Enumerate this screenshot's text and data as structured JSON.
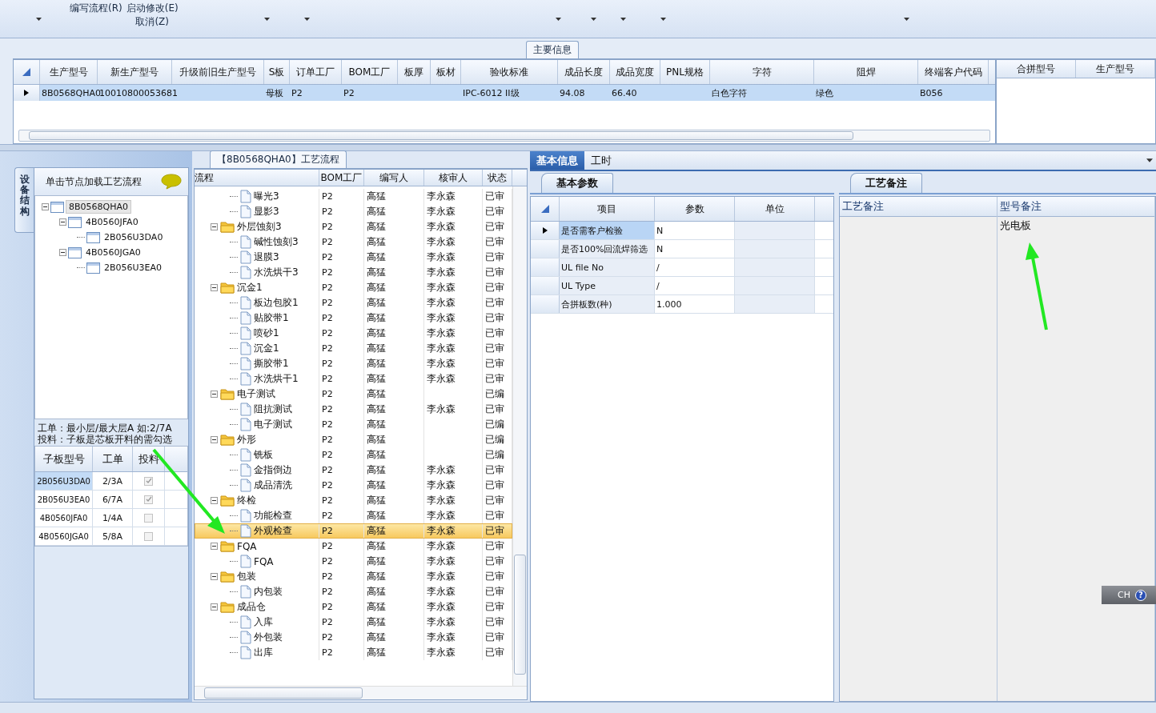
{
  "toolbar": [
    {
      "dropdown": true
    },
    {
      "lines": [
        "编写流程(R)"
      ]
    },
    {
      "lines": [
        "启动修改(E)",
        "取消(Z)"
      ]
    },
    {
      "dropdown": true
    },
    {
      "dropdown": true
    },
    {
      "dropdown": true
    },
    {
      "dropdown": true
    },
    {
      "dropdown": true
    },
    {
      "dropdown": true
    },
    {
      "dropdown": true
    }
  ],
  "main_info": {
    "title": "主要信息",
    "columns": [
      "生产型号",
      "新生产型号",
      "升级前旧生产型号",
      "S板",
      "订单工厂",
      "BOM工厂",
      "板厚",
      "板材",
      "验收标准",
      "成品长度",
      "成品宽度",
      "PNL规格",
      "字符",
      "阻焊",
      "终端客户代码"
    ],
    "rows": [
      {
        "selected": true,
        "cells": [
          "8B0568QHA0",
          "10010800053681",
          null,
          "母板",
          "P2",
          "P2",
          null,
          null,
          "IPC-6012 II级",
          "94.08",
          "66.40",
          null,
          "白色字符",
          "绿色",
          "B056"
        ]
      }
    ]
  },
  "merge_grid": {
    "columns": [
      "合拼型号",
      "生产型号"
    ]
  },
  "structure_panel": {
    "tab": "设备结构",
    "hint": "单击节点加载工艺流程",
    "tree": [
      {
        "label": "8B0568QHA0",
        "expanded": true,
        "selected": true,
        "children": [
          {
            "label": "4B0560JFA0",
            "expanded": true,
            "selected": false,
            "children": [
              {
                "label": "2B056U3DA0",
                "selected": false
              }
            ]
          },
          {
            "label": "4B0560JGA0",
            "expanded": true,
            "selected": false,
            "children": [
              {
                "label": "2B056U3EA0",
                "selected": false
              }
            ]
          }
        ]
      }
    ],
    "notes": [
      "工单：最小层/最大层A 如:2/7A",
      "投料：子板是芯板开料的需勾选"
    ],
    "sub_grid": {
      "columns": [
        "子板型号",
        "工单",
        "投料"
      ],
      "rows": [
        {
          "board": "2B056U3DA0",
          "order": "2/3A",
          "checked": true,
          "selected": true
        },
        {
          "board": "2B056U3EA0",
          "order": "6/7A",
          "checked": true,
          "selected": false
        },
        {
          "board": "4B0560JFA0",
          "order": "1/4A",
          "checked": false,
          "selected": false
        },
        {
          "board": "4B0560JGA0",
          "order": "5/8A",
          "checked": false,
          "selected": false
        }
      ]
    }
  },
  "process": {
    "title": "【8B0568QHA0】工艺流程",
    "columns": [
      "流程",
      "BOM工厂",
      "编写人",
      "核审人",
      "状态"
    ],
    "nodes": [
      {
        "kind": "step",
        "name": "曝光3",
        "factory": "P2",
        "writer": "高猛",
        "reviewer": "李永森",
        "status": "已审",
        "selected": false
      },
      {
        "kind": "step",
        "name": "显影3",
        "factory": "P2",
        "writer": "高猛",
        "reviewer": "李永森",
        "status": "已审",
        "selected": false
      },
      {
        "kind": "group",
        "name": "外层蚀刻3",
        "factory": "P2",
        "writer": "高猛",
        "reviewer": "李永森",
        "status": "已审",
        "selected": false,
        "expanded": true,
        "children": [
          {
            "kind": "step",
            "name": "碱性蚀刻3",
            "factory": "P2",
            "writer": "高猛",
            "reviewer": "李永森",
            "status": "已审",
            "selected": false
          },
          {
            "kind": "step",
            "name": "退膜3",
            "factory": "P2",
            "writer": "高猛",
            "reviewer": "李永森",
            "status": "已审",
            "selected": false
          },
          {
            "kind": "step",
            "name": "水洗烘干3",
            "factory": "P2",
            "writer": "高猛",
            "reviewer": "李永森",
            "status": "已审",
            "selected": false
          }
        ]
      },
      {
        "kind": "group",
        "name": "沉金1",
        "factory": "P2",
        "writer": "高猛",
        "reviewer": "李永森",
        "status": "已审",
        "selected": false,
        "expanded": true,
        "children": [
          {
            "kind": "step",
            "name": "板边包胶1",
            "factory": "P2",
            "writer": "高猛",
            "reviewer": "李永森",
            "status": "已审",
            "selected": false
          },
          {
            "kind": "step",
            "name": "贴胶带1",
            "factory": "P2",
            "writer": "高猛",
            "reviewer": "李永森",
            "status": "已审",
            "selected": false
          },
          {
            "kind": "step",
            "name": "喷砂1",
            "factory": "P2",
            "writer": "高猛",
            "reviewer": "李永森",
            "status": "已审",
            "selected": false
          },
          {
            "kind": "step",
            "name": "沉金1",
            "factory": "P2",
            "writer": "高猛",
            "reviewer": "李永森",
            "status": "已审",
            "selected": false
          },
          {
            "kind": "step",
            "name": "撕胶带1",
            "factory": "P2",
            "writer": "高猛",
            "reviewer": "李永森",
            "status": "已审",
            "selected": false
          },
          {
            "kind": "step",
            "name": "水洗烘干1",
            "factory": "P2",
            "writer": "高猛",
            "reviewer": "李永森",
            "status": "已审",
            "selected": false
          }
        ]
      },
      {
        "kind": "group",
        "name": "电子测试",
        "factory": "P2",
        "writer": "高猛",
        "status": "已编",
        "selected": false,
        "expanded": true,
        "children": [
          {
            "kind": "step",
            "name": "阻抗测试",
            "factory": "P2",
            "writer": "高猛",
            "reviewer": "李永森",
            "status": "已审",
            "selected": false
          },
          {
            "kind": "step",
            "name": "电子测试",
            "factory": "P2",
            "writer": "高猛",
            "status": "已编",
            "selected": false
          }
        ]
      },
      {
        "kind": "group",
        "name": "外形",
        "factory": "P2",
        "writer": "高猛",
        "status": "已编",
        "selected": false,
        "expanded": true,
        "children": [
          {
            "kind": "step",
            "name": "铣板",
            "factory": "P2",
            "writer": "高猛",
            "status": "已编",
            "selected": false
          },
          {
            "kind": "step",
            "name": "金指倒边",
            "factory": "P2",
            "writer": "高猛",
            "reviewer": "李永森",
            "status": "已审",
            "selected": false
          },
          {
            "kind": "step",
            "name": "成品清洗",
            "factory": "P2",
            "writer": "高猛",
            "reviewer": "李永森",
            "status": "已审",
            "selected": false
          }
        ]
      },
      {
        "kind": "group",
        "name": "终检",
        "factory": "P2",
        "writer": "高猛",
        "reviewer": "李永森",
        "status": "已审",
        "selected": false,
        "expanded": true,
        "children": [
          {
            "kind": "step",
            "name": "功能检查",
            "factory": "P2",
            "writer": "高猛",
            "reviewer": "李永森",
            "status": "已审",
            "selected": false
          },
          {
            "kind": "step",
            "name": "外观检查",
            "factory": "P2",
            "writer": "高猛",
            "reviewer": "李永森",
            "status": "已审",
            "selected": true
          }
        ]
      },
      {
        "kind": "group",
        "name": "FQA",
        "factory": "P2",
        "writer": "高猛",
        "reviewer": "李永森",
        "status": "已审",
        "selected": false,
        "expanded": true,
        "children": [
          {
            "kind": "step",
            "name": "FQA",
            "factory": "P2",
            "writer": "高猛",
            "reviewer": "李永森",
            "status": "已审",
            "selected": false
          }
        ]
      },
      {
        "kind": "group",
        "name": "包装",
        "factory": "P2",
        "writer": "高猛",
        "reviewer": "李永森",
        "status": "已审",
        "selected": false,
        "expanded": true,
        "children": [
          {
            "kind": "step",
            "name": "内包装",
            "factory": "P2",
            "writer": "高猛",
            "reviewer": "李永森",
            "status": "已审",
            "selected": false
          }
        ]
      },
      {
        "kind": "group",
        "name": "成品仓",
        "factory": "P2",
        "writer": "高猛",
        "reviewer": "李永森",
        "status": "已审",
        "selected": false,
        "expanded": true,
        "children": [
          {
            "kind": "step",
            "name": "入库",
            "factory": "P2",
            "writer": "高猛",
            "reviewer": "李永森",
            "status": "已审",
            "selected": false
          },
          {
            "kind": "step",
            "name": "外包装",
            "factory": "P2",
            "writer": "高猛",
            "reviewer": "李永森",
            "status": "已审",
            "selected": false
          },
          {
            "kind": "step",
            "name": "出库",
            "factory": "P2",
            "writer": "高猛",
            "reviewer": "李永森",
            "status": "已审",
            "selected": false
          }
        ]
      }
    ]
  },
  "detail": {
    "tabs": [
      {
        "label": "基本信息",
        "selected": true
      },
      {
        "label": "工时",
        "selected": false
      }
    ],
    "params": {
      "tab": "基本参数",
      "columns": [
        "项目",
        "参数",
        "单位"
      ],
      "rows": [
        {
          "item": "是否需客户检验",
          "value": "N",
          "selected": true
        },
        {
          "item": "是否100%回流焊筛选",
          "value": "N",
          "selected": false
        },
        {
          "item": "UL file No",
          "value": "/",
          "selected": false
        },
        {
          "item": "UL Type",
          "value": "/",
          "selected": false
        },
        {
          "item": "合拼板数(种)",
          "value": "1.000",
          "selected": false
        }
      ]
    },
    "remarks": {
      "tab": "工艺备注",
      "columns": [
        "工艺备注",
        "型号备注"
      ],
      "model_remark": "光电板"
    }
  },
  "language_bar": {
    "label": "CH",
    "help": "?"
  }
}
